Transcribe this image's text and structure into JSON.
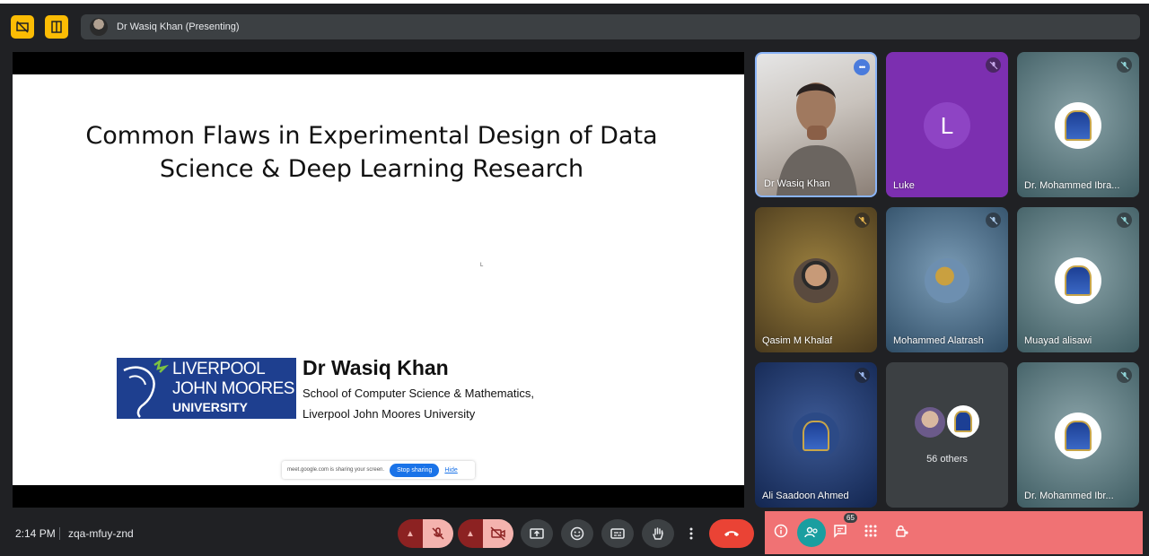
{
  "meeting": {
    "presenter_label": "Dr Wasiq Khan (Presenting)",
    "time": "2:14 PM",
    "code": "zqa-mfuy-znd"
  },
  "slide": {
    "title_line1": "Common Flaws in Experimental Design of Data",
    "title_line2": "Science & Deep Learning Research",
    "logo_line1": "LIVERPOOL",
    "logo_line2": "JOHN MOORES",
    "logo_line3": "UNIVERSITY",
    "author": "Dr Wasiq Khan",
    "affiliation_line1": "School of Computer Science & Mathematics,",
    "affiliation_line2": "Liverpool John Moores University",
    "cursor_mark": "L"
  },
  "share_banner": {
    "message": "meet.google.com is sharing your screen.",
    "stop_label": "Stop sharing",
    "hide_label": "Hide"
  },
  "participants": [
    {
      "name": "Dr Wasiq Khan",
      "options": "•••"
    },
    {
      "name": "Luke",
      "initial": "L"
    },
    {
      "name": "Dr. Mohammed Ibra..."
    },
    {
      "name": "Qasim M Khalaf"
    },
    {
      "name": "Mohammed Alatrash"
    },
    {
      "name": "Muayad alisawi"
    },
    {
      "name": "Ali Saadoon Ahmed"
    },
    {
      "others_label": "56 others"
    },
    {
      "name": "Dr. Mohammed Ibr..."
    }
  ],
  "people_count": "65",
  "colors": {
    "accent_yellow": "#fbbc04",
    "leave_red": "#ea4335",
    "panel_pink": "#f07274",
    "people_teal": "#1a9ea0"
  }
}
